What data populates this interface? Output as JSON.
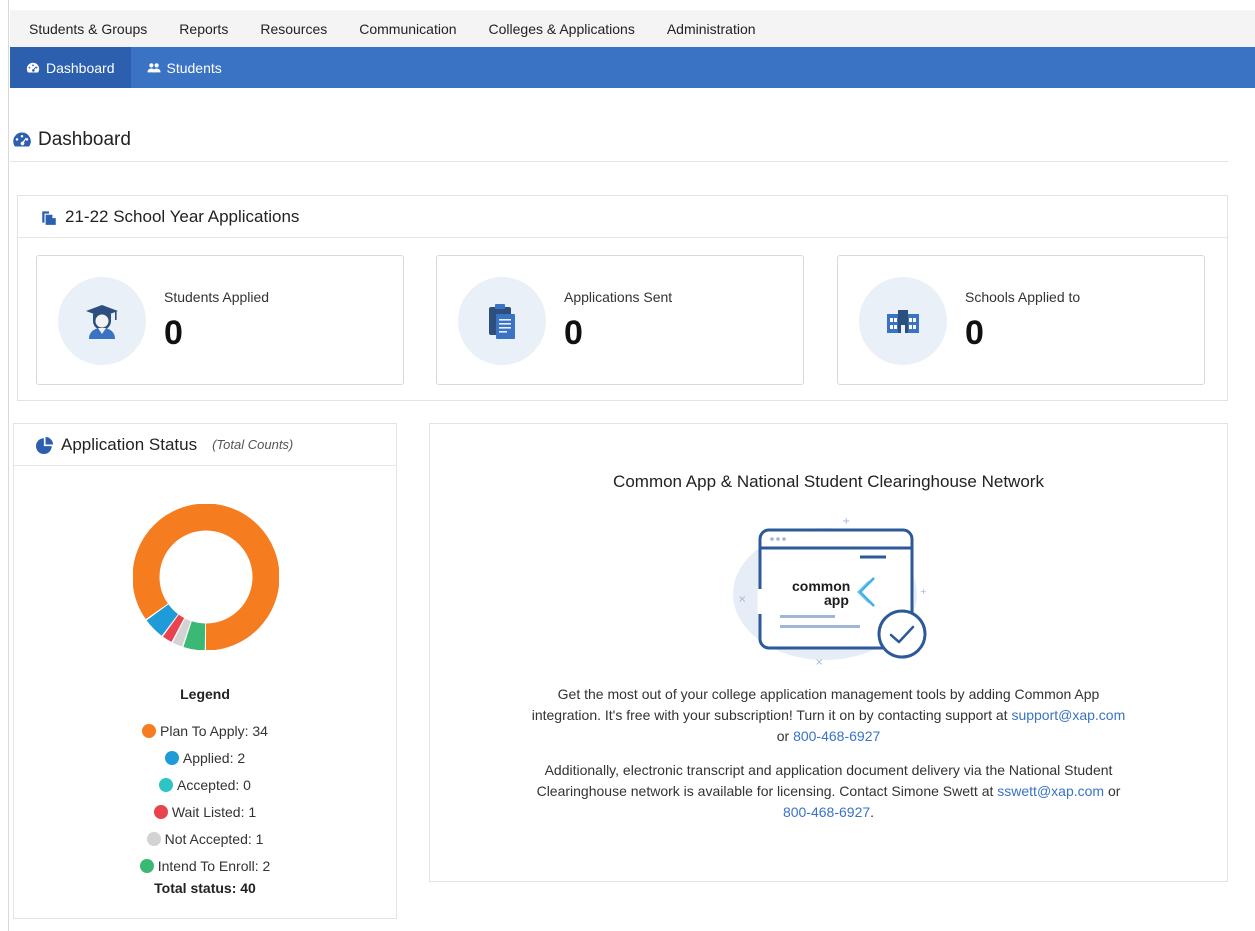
{
  "topnav": {
    "items": [
      "Students & Groups",
      "Reports",
      "Resources",
      "Communication",
      "Colleges & Applications",
      "Administration"
    ]
  },
  "subnav": {
    "tabs": [
      {
        "label": "Dashboard",
        "icon": "dashboard-icon",
        "active": true
      },
      {
        "label": "Students",
        "icon": "users-icon",
        "active": false
      }
    ]
  },
  "page": {
    "title": "Dashboard",
    "title_icon": "dashboard-icon"
  },
  "applications": {
    "heading": "21-22 School Year Applications",
    "heading_icon": "documents-icon",
    "stats": [
      {
        "label": "Students Applied",
        "value": "0",
        "icon": "graduate-icon"
      },
      {
        "label": "Applications Sent",
        "value": "0",
        "icon": "clipboard-icon"
      },
      {
        "label": "Schools Applied to",
        "value": "0",
        "icon": "school-building-icon"
      }
    ]
  },
  "status": {
    "heading": "Application Status",
    "note": "(Total Counts)",
    "heading_icon": "pie-chart-icon",
    "legend_title": "Legend",
    "legend": [
      {
        "label": "Plan To Apply: 34",
        "count": 34,
        "color": "#f57c1f"
      },
      {
        "label": "Applied: 2",
        "count": 2,
        "color": "#1f9bd7"
      },
      {
        "label": "Accepted: 0",
        "count": 0,
        "color": "#2ec4c4"
      },
      {
        "label": "Wait Listed: 1",
        "count": 1,
        "color": "#e8434f"
      },
      {
        "label": "Not Accepted: 1",
        "count": 1,
        "color": "#d3d3d3"
      },
      {
        "label": "Intend To Enroll: 2",
        "count": 2,
        "color": "#3bb873"
      }
    ],
    "total": "Total status: 40"
  },
  "commonapp": {
    "title": "Common App & National Student Clearinghouse Network",
    "logo_line1": "common",
    "logo_line2": "app",
    "para1_text": "Get the most out of your college application management tools by adding Common App integration. It's free with your subscription! Turn it on by contacting support at",
    "para1_email": "support@xap.com",
    "para1_or": "or",
    "para1_phone": "800-468-6927",
    "para2_text": "Additionally, electronic transcript and application document delivery via the National Student Clearinghouse network is available for licensing. Contact Simone Swett at",
    "para2_email": "sswett@xap.com",
    "para2_or": "or",
    "para2_phone": "800-468-6927",
    "para2_end": "."
  },
  "colors": {
    "brand_blue": "#3a72c4",
    "brand_blue_dark": "#2c5fad"
  }
}
